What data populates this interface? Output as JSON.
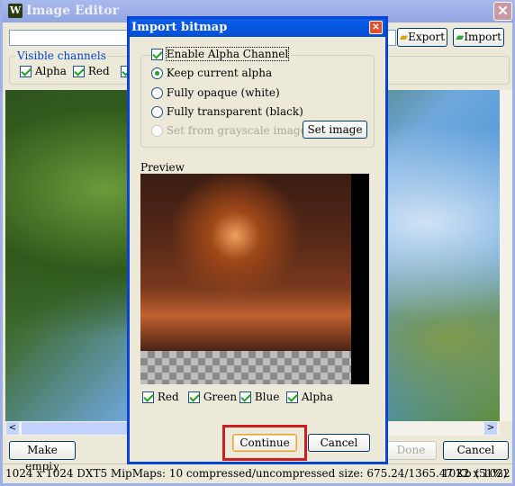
{
  "window": {
    "title": "Image Editor",
    "app_icon": "W",
    "path_value": "",
    "export_label": "Export",
    "import_label": "Import",
    "channels_label": "Visible channels",
    "channels": [
      {
        "label": "Alpha",
        "checked": true
      },
      {
        "label": "Red",
        "checked": true
      }
    ],
    "make_empty_label": "Make empty",
    "done_label": "Done",
    "cancel_label": "Cancel",
    "status_text": "1024 x 1024 DXT5 MipMaps: 10 compressed/uncompressed size: 675.24/1365.47 Kb (51%)",
    "status_dims": "1022 x 1022"
  },
  "dialog": {
    "title": "Import bitmap",
    "enable_alpha_label": "Enable Alpha Channel",
    "enable_alpha_checked": true,
    "options": [
      {
        "label": "Keep current alpha",
        "selected": true,
        "enabled": true
      },
      {
        "label": "Fully opaque (white)",
        "selected": false,
        "enabled": true
      },
      {
        "label": "Fully transparent (black)",
        "selected": false,
        "enabled": true
      },
      {
        "label": "Set from grayscale image",
        "selected": false,
        "enabled": false
      }
    ],
    "set_image_label": "Set image",
    "preview_label": "Preview",
    "channels": [
      {
        "label": "Red",
        "checked": true
      },
      {
        "label": "Green",
        "checked": true
      },
      {
        "label": "Blue",
        "checked": true
      },
      {
        "label": "Alpha",
        "checked": true
      }
    ],
    "continue_label": "Continue",
    "cancel_label": "Cancel",
    "highlight_color": "#cc1f1f"
  }
}
